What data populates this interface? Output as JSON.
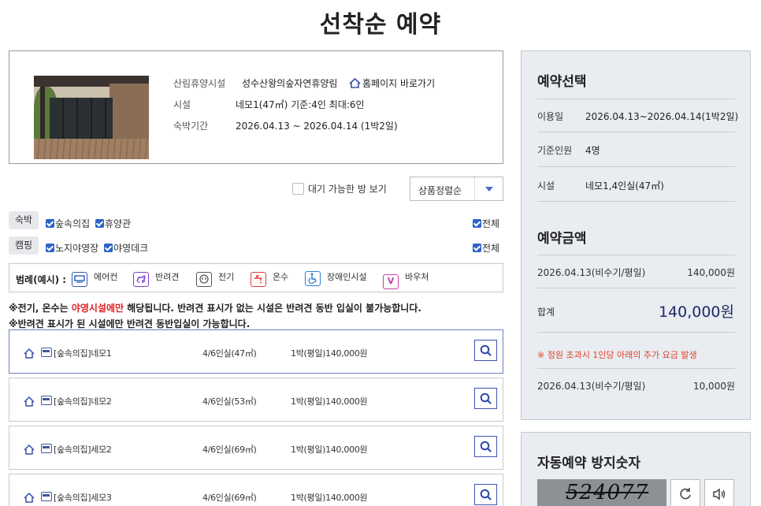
{
  "page": {
    "title": "선착순 예약"
  },
  "facility": {
    "label_forest": "산림휴양시설",
    "forest_name": "성수산왕의숲자연휴양림",
    "homepage_link": "홈페이지 바로가기",
    "label_facility": "시설",
    "facility_value": "네모1(47㎡) 기준:4인 최대:6인",
    "label_period": "숙박기간",
    "period_value": "2026.04.13 ~ 2026.04.14 (1박2일)"
  },
  "filters": {
    "waitlist_label": "대기 가능한 방 보기",
    "sort_value": "상품정렬순",
    "stay_label": "숙박",
    "stay_options": [
      "숲속의집",
      "휴양관"
    ],
    "camp_label": "캠핑",
    "camp_options": [
      "노지야영장",
      "야영데크"
    ],
    "all_label": "전체"
  },
  "legend": {
    "title": "범례(예시) :",
    "items": [
      {
        "label": "에어컨",
        "icon": "aircon-icon",
        "color": "#2f57b8"
      },
      {
        "label": "반려견",
        "icon": "dog-icon",
        "color": "#7b3fc8"
      },
      {
        "label": "전기",
        "icon": "plug-icon",
        "color": "#555555"
      },
      {
        "label": "온수",
        "icon": "faucet-icon",
        "color": "#e03a3a"
      },
      {
        "label": "장애인시설",
        "icon": "wheelchair-icon",
        "color": "#2b7fd4"
      },
      {
        "label": "바우처",
        "icon": "voucher-icon",
        "color": "#c93ea9",
        "glyph": "V"
      }
    ]
  },
  "notes": {
    "line1_prefix": "※전기, 온수는 ",
    "line1_red": "야영시설에만",
    "line1_suffix": " 해당됩니다. 반려견 표시가 없는 시설은 반려견 동반 입실이 불가능합니다.",
    "line2": "※반려견 표시가 된 시설에만 반려견 동반입실이 가능합니다."
  },
  "rooms": [
    {
      "name": "[숲속의집]네모1",
      "capacity": "4/6인실(47㎡)",
      "price": "1박(평일)140,000원"
    },
    {
      "name": "[숲속의집]네모2",
      "capacity": "4/6인실(53㎡)",
      "price": "1박(평일)140,000원"
    },
    {
      "name": "[숲속의집]세모2",
      "capacity": "4/6인실(69㎡)",
      "price": "1박(평일)140,000원"
    },
    {
      "name": "[숲속의집]세모3",
      "capacity": "4/6인실(69㎡)",
      "price": "1박(평일)140,000원"
    }
  ],
  "summary": {
    "title": "예약선택",
    "use_label": "이용일",
    "use_value": "2026.04.13~2026.04.14(1박2일)",
    "people_label": "기준인원",
    "people_value": "4명",
    "facility_label": "시설",
    "facility_value": "네모1,4인실(47㎡)",
    "amount_title": "예약금액",
    "line_date": "2026.04.13(비수기/평일)",
    "line_amount": "140,000원",
    "total_label": "합계",
    "total_value": "140,000원",
    "extra_note": "※ 정원 초과시 1인당 아래의 추가 요금 발생",
    "extra_date": "2026.04.13(비수기/평일)",
    "extra_amount": "10,000원"
  },
  "captcha": {
    "title": "자동예약 방지숫자",
    "code": "524077"
  }
}
